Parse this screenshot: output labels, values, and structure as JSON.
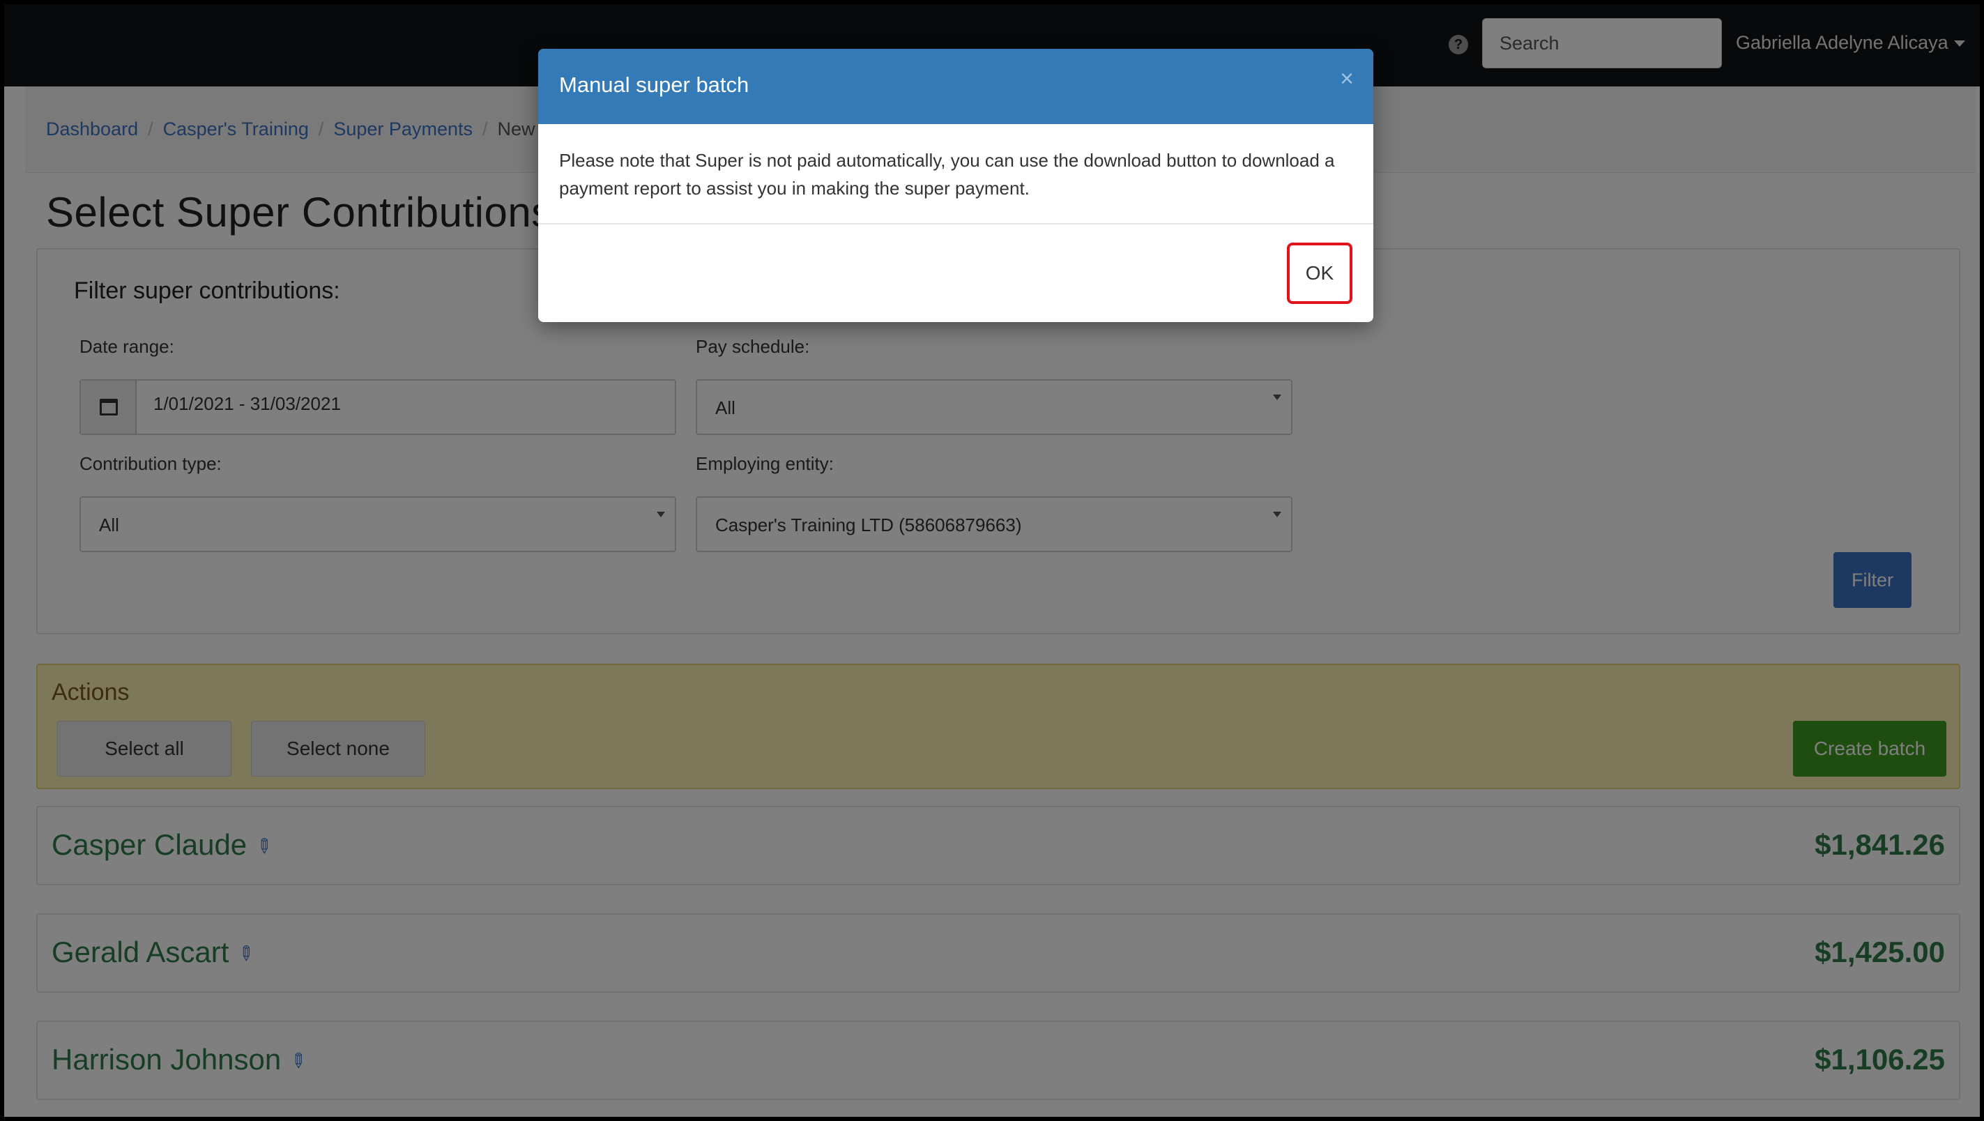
{
  "topbar": {
    "help_icon": "question-circle-icon",
    "search_placeholder": "Search",
    "user_name": "Gabriella Adelyne Alicaya"
  },
  "breadcrumb": {
    "items": [
      "Dashboard",
      "Casper's Training",
      "Super Payments"
    ],
    "current": "New"
  },
  "page": {
    "title": "Select Super Contributions"
  },
  "filter": {
    "title": "Filter super contributions:",
    "date_range_label": "Date range:",
    "date_range_value": "1/01/2021 - 31/03/2021",
    "date_icon": "calendar-icon",
    "pay_schedule_label": "Pay schedule:",
    "pay_schedule_value": "All",
    "contribution_type_label": "Contribution type:",
    "contribution_type_value": "All",
    "employing_entity_label": "Employing entity:",
    "employing_entity_value": "Casper's Training LTD (58606879663)",
    "filter_button": "Filter"
  },
  "actions": {
    "title": "Actions",
    "select_all": "Select all",
    "select_none": "Select none",
    "create_batch": "Create batch"
  },
  "employees": [
    {
      "name": "Casper Claude",
      "amount": "$1,841.26"
    },
    {
      "name": "Gerald Ascart",
      "amount": "$1,425.00"
    },
    {
      "name": "Harrison Johnson",
      "amount": "$1,106.25"
    }
  ],
  "modal": {
    "title": "Manual super batch",
    "close": "×",
    "body": "Please note that Super is not paid automatically, you can use the download button to download a payment report to assist you in making the super payment.",
    "ok": "OK"
  },
  "colors": {
    "topbar": "#0f1215",
    "modal_header": "#337ab7",
    "link": "#3a73c3",
    "employee_green": "#2e7d4a",
    "create_batch": "#3d9a1e",
    "highlight_red": "#e0131b"
  }
}
